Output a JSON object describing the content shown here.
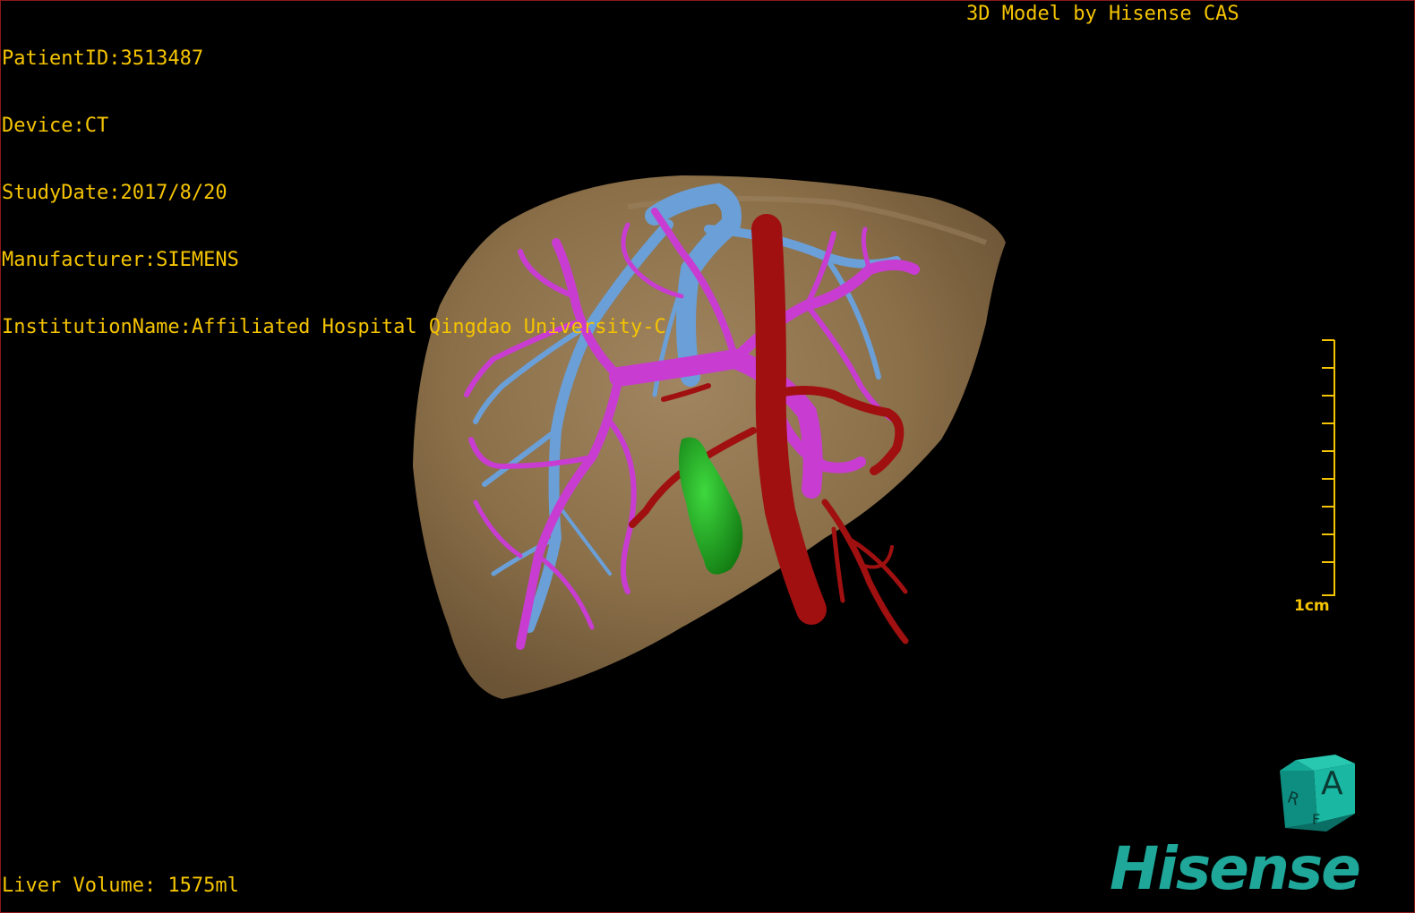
{
  "overlay": {
    "patient_id": "PatientID:3513487",
    "device": "Device:CT",
    "study_date": "StudyDate:2017/8/20",
    "manufacturer": "Manufacturer:SIEMENS",
    "institution": "InstitutionName:Affiliated Hospital Qingdao University-C",
    "title": "3D Model by Hisense CAS",
    "liver_volume": "Liver Volume: 1575ml"
  },
  "scale": {
    "label": "1cm"
  },
  "orientation_cube": {
    "front_letter": "A",
    "side_letter": "R",
    "bottom_letter": "F"
  },
  "logo": {
    "text": "Hisense"
  },
  "colors": {
    "overlay_text": "#f5c400",
    "liver": "#8a6f48",
    "portal_vein": "#c83cd2",
    "hepatic_vein": "#6a9fd8",
    "artery_ivc": "#a01010",
    "gallbladder": "#1e9a1e",
    "brand": "#1fa89a",
    "frame": "#8b1a1a"
  }
}
